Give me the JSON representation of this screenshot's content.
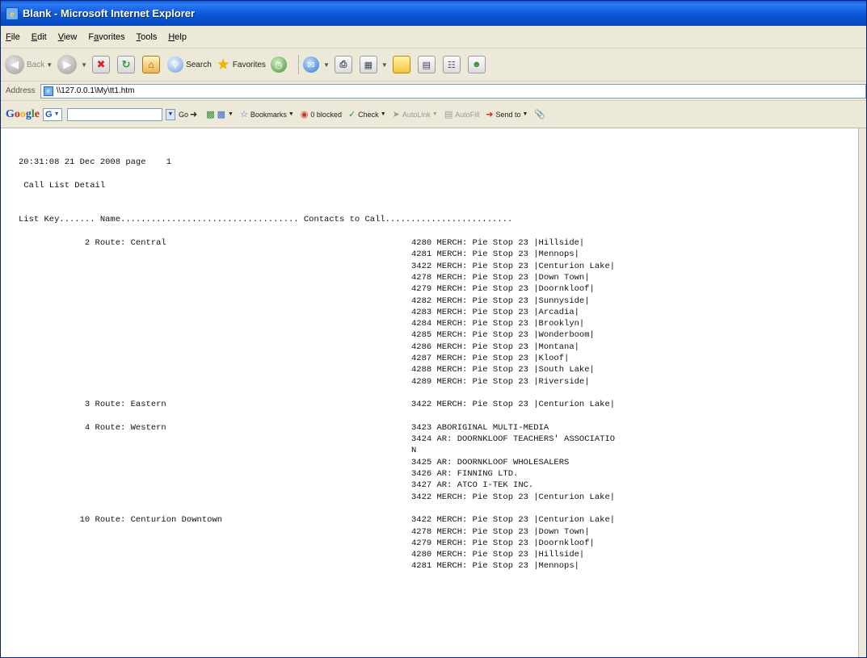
{
  "window": {
    "title": "Blank - Microsoft Internet Explorer"
  },
  "menu": [
    {
      "label": "File",
      "u": "F",
      "rest": "ile"
    },
    {
      "label": "Edit",
      "u": "E",
      "rest": "dit"
    },
    {
      "label": "View",
      "u": "V",
      "rest": "iew"
    },
    {
      "label": "Favorites",
      "u": "a",
      "pre": "F",
      "rest": "vorites"
    },
    {
      "label": "Tools",
      "u": "T",
      "rest": "ools"
    },
    {
      "label": "Help",
      "u": "H",
      "rest": "elp"
    }
  ],
  "toolbar": {
    "back_label": "Back",
    "search_label": "Search",
    "favorites_label": "Favorites"
  },
  "address": {
    "label": "Address",
    "url": "\\\\127.0.0.1\\My\\tt1.htm"
  },
  "google": {
    "g_box": "G",
    "go_label": "Go",
    "bookmarks_label": "Bookmarks",
    "blocked_label": "0 blocked",
    "check_label": "Check",
    "autolink_label": "AutoLink",
    "autofill_label": "AutoFill",
    "sendto_label": "Send to"
  },
  "report": {
    "header_line": "20:31:08 21 Dec 2008 page    1",
    "title_line": " Call List Detail",
    "columns_line": "List Key....... Name................................... Contacts to Call.........................",
    "groups": [
      {
        "key": "             2 Route: Central",
        "contacts": [
          "4280 MERCH: Pie Stop 23 |Hillside|",
          "4281 MERCH: Pie Stop 23 |Mennops|",
          "3422 MERCH: Pie Stop 23 |Centurion Lake|",
          "4278 MERCH: Pie Stop 23 |Down Town|",
          "4279 MERCH: Pie Stop 23 |Doornkloof|",
          "4282 MERCH: Pie Stop 23 |Sunnyside|",
          "4283 MERCH: Pie Stop 23 |Arcadia|",
          "4284 MERCH: Pie Stop 23 |Brooklyn|",
          "4285 MERCH: Pie Stop 23 |Wonderboom|",
          "4286 MERCH: Pie Stop 23 |Montana|",
          "4287 MERCH: Pie Stop 23 |Kloof|",
          "4288 MERCH: Pie Stop 23 |South Lake|",
          "4289 MERCH: Pie Stop 23 |Riverside|"
        ]
      },
      {
        "key": "             3 Route: Eastern",
        "contacts": [
          "3422 MERCH: Pie Stop 23 |Centurion Lake|"
        ]
      },
      {
        "key": "             4 Route: Western",
        "contacts": [
          "3423 ABORIGINAL MULTI-MEDIA",
          "3424 AR: DOORNKLOOF TEACHERS' ASSOCIATIO",
          "N",
          "3425 AR: DOORNKLOOF WHOLESALERS",
          "3426 AR: FINNING LTD.",
          "3427 AR: ATCO I-TEK INC.",
          "3422 MERCH: Pie Stop 23 |Centurion Lake|"
        ]
      },
      {
        "key": "            10 Route: Centurion Downtown",
        "contacts": [
          "3422 MERCH: Pie Stop 23 |Centurion Lake|",
          "4278 MERCH: Pie Stop 23 |Down Town|",
          "4279 MERCH: Pie Stop 23 |Doornkloof|",
          "4280 MERCH: Pie Stop 23 |Hillside|",
          "4281 MERCH: Pie Stop 23 |Mennops|"
        ]
      }
    ]
  }
}
